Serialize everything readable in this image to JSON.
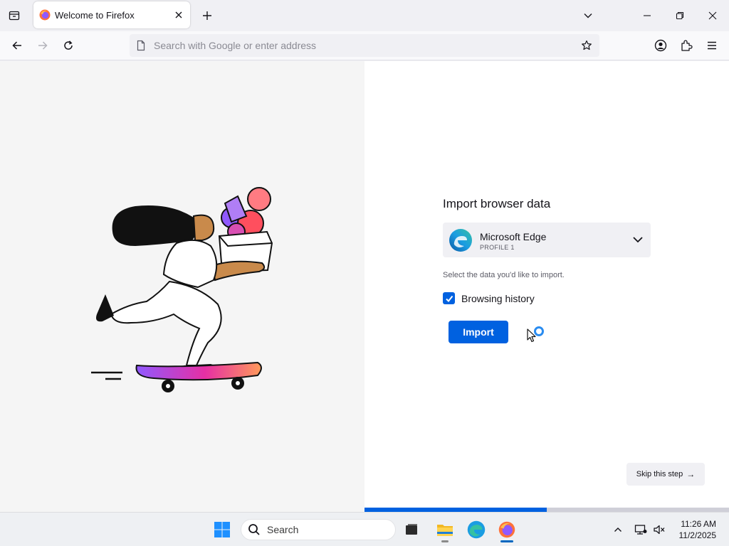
{
  "browser": {
    "tab": {
      "title": "Welcome to Firefox"
    },
    "urlbar": {
      "placeholder": "Search with Google or enter address"
    }
  },
  "import": {
    "title": "Import browser data",
    "selected_browser": {
      "name": "Microsoft Edge",
      "profile": "PROFILE 1"
    },
    "hint": "Select the data you'd like to import.",
    "options": [
      {
        "label": "Browsing history",
        "checked": true
      }
    ],
    "import_label": "Import",
    "skip_label": "Skip this step",
    "progress": 0.5
  },
  "taskbar": {
    "search_label": "Search",
    "time": "11:26 AM",
    "date": "11/2/2025"
  },
  "colors": {
    "accent": "#0061e0",
    "progress_track": "#cfcfd8"
  }
}
